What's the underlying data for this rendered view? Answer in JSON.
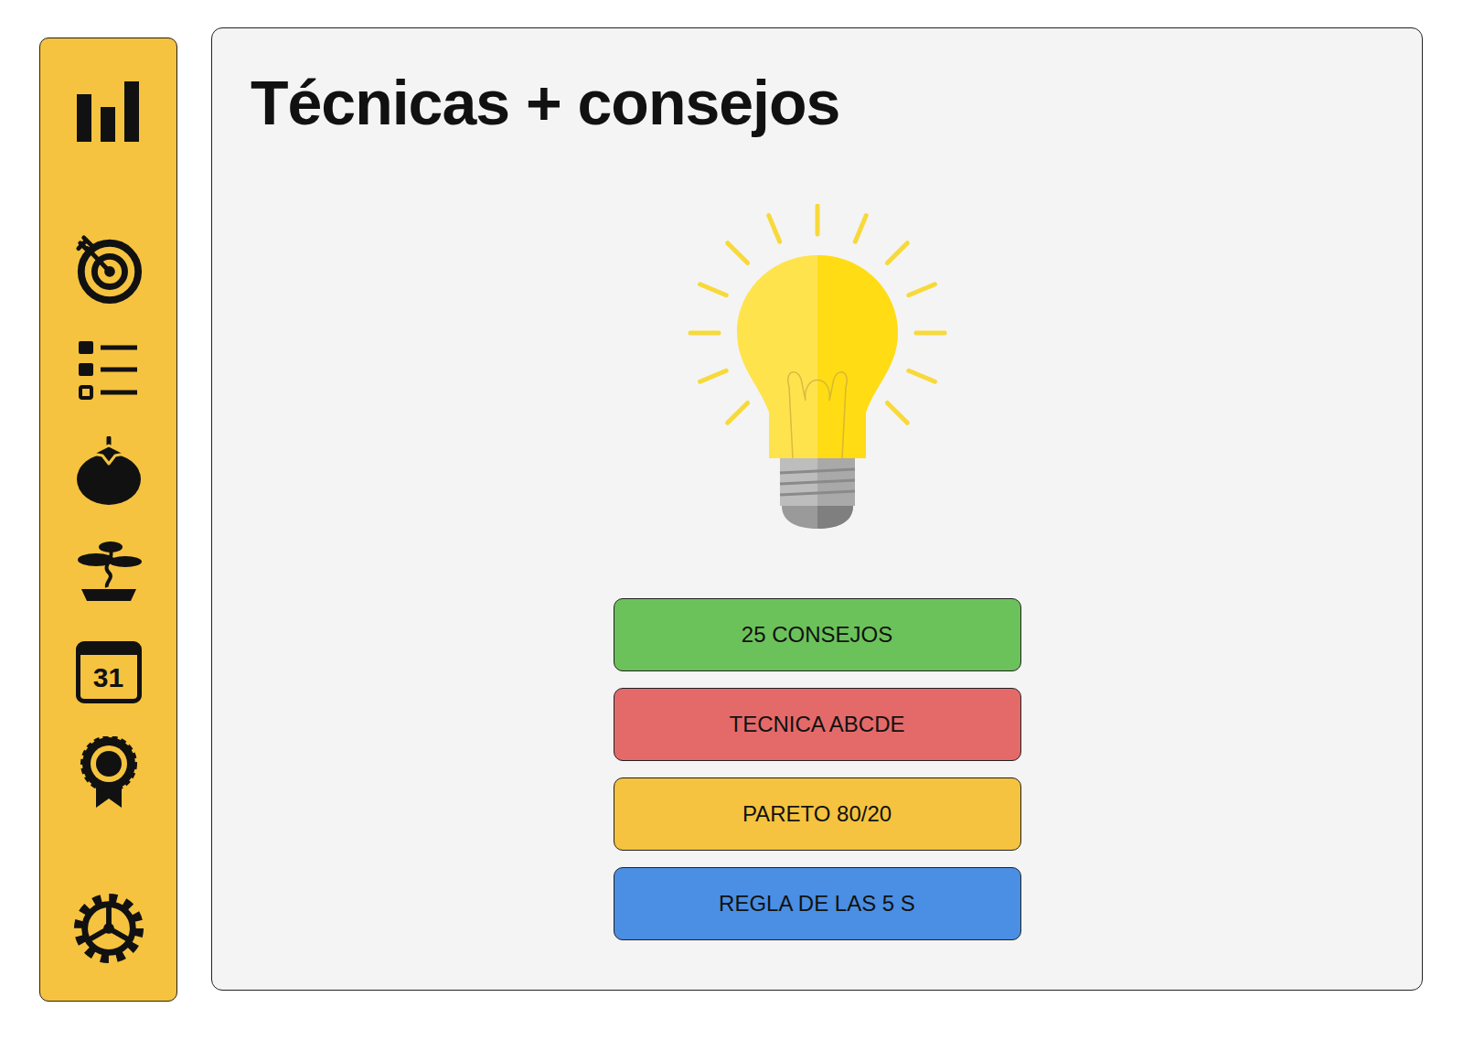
{
  "title": "Técnicas + consejos",
  "sidebar": {
    "calendar_day": "31"
  },
  "buttons": [
    {
      "label": "25 CONSEJOS",
      "color": "#6cc25a"
    },
    {
      "label": "TECNICA ABCDE",
      "color": "#e46a6a"
    },
    {
      "label": "PARETO 80/20",
      "color": "#f5c33f"
    },
    {
      "label": "REGLA DE LAS 5 S",
      "color": "#4a8fe3"
    }
  ]
}
